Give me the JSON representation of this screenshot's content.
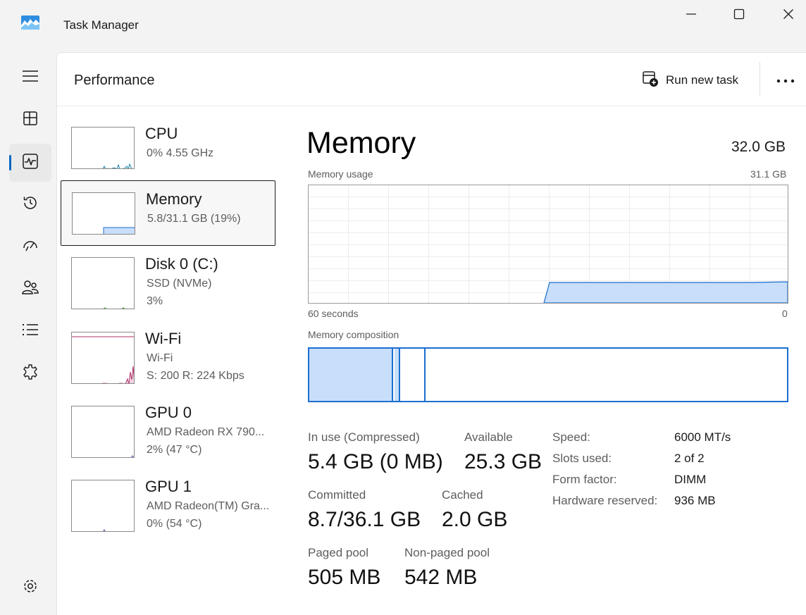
{
  "window": {
    "title": "Task Manager",
    "controls": {
      "minimize": "minimize-icon",
      "maximize": "maximize-icon",
      "close": "close-icon"
    }
  },
  "nav": {
    "items": [
      {
        "icon": "hamburger-menu-icon",
        "name": "menu"
      },
      {
        "icon": "processes-icon",
        "name": "processes"
      },
      {
        "icon": "performance-icon",
        "name": "performance",
        "active": true
      },
      {
        "icon": "app-history-icon",
        "name": "app-history"
      },
      {
        "icon": "startup-apps-icon",
        "name": "startup-apps"
      },
      {
        "icon": "users-icon",
        "name": "users"
      },
      {
        "icon": "details-icon",
        "name": "details"
      },
      {
        "icon": "services-icon",
        "name": "services"
      },
      {
        "icon": "settings-icon",
        "name": "settings"
      }
    ]
  },
  "header": {
    "title": "Performance",
    "run_new_task": "Run new task",
    "more_icon": "more-options-icon"
  },
  "resources": [
    {
      "title": "CPU",
      "line1": "0%  4.55 GHz",
      "line2": ""
    },
    {
      "title": "Memory",
      "line1": "5.8/31.1 GB (19%)",
      "line2": "",
      "selected": true
    },
    {
      "title": "Disk 0 (C:)",
      "line1": "SSD (NVMe)",
      "line2": "3%"
    },
    {
      "title": "Wi-Fi",
      "line1": "Wi-Fi",
      "line2": "S: 200  R: 224 Kbps"
    },
    {
      "title": "GPU 0",
      "line1": "AMD Radeon RX 790...",
      "line2": "2%  (47 °C)"
    },
    {
      "title": "GPU 1",
      "line1": "AMD Radeon(TM) Gra...",
      "line2": "0%  (54 °C)"
    }
  ],
  "memory": {
    "title": "Memory",
    "total": "32.0 GB",
    "usage_label": "Memory usage",
    "usage_max": "31.1 GB",
    "axis_left": "60 seconds",
    "axis_right": "0",
    "composition_label": "Memory composition",
    "composition_fractions": {
      "in_use": 0.175,
      "modified": 0.014,
      "standby": 0.053
    },
    "stats": {
      "in_use_label": "In use (Compressed)",
      "in_use_value": "5.4 GB (0 MB)",
      "available_label": "Available",
      "available_value": "25.3 GB",
      "committed_label": "Committed",
      "committed_value": "8.7/36.1 GB",
      "cached_label": "Cached",
      "cached_value": "2.0 GB",
      "paged_label": "Paged pool",
      "paged_value": "505 MB",
      "nonpaged_label": "Non-paged pool",
      "nonpaged_value": "542 MB"
    },
    "specs": [
      {
        "label": "Speed:",
        "value": "6000 MT/s"
      },
      {
        "label": "Slots used:",
        "value": "2 of 2"
      },
      {
        "label": "Form factor:",
        "value": "DIMM"
      },
      {
        "label": "Hardware reserved:",
        "value": "936 MB"
      }
    ]
  },
  "colors": {
    "accent": "#0067c0",
    "memory_stroke": "#1a6fd0",
    "memory_fill": "#c8defa",
    "cpu_line": "#1b7fa8",
    "wifi_line": "#b0326a",
    "disk_line": "#4a9a2a"
  }
}
